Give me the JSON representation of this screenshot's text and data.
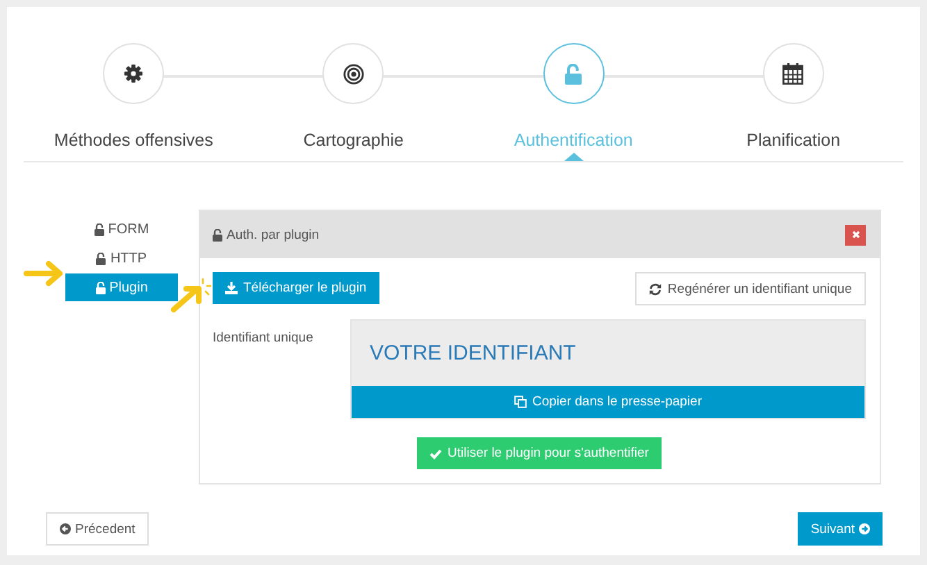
{
  "steps": [
    {
      "label": "Méthodes offensives",
      "kind": "gear",
      "selected": false
    },
    {
      "label": "Cartographie",
      "kind": "target",
      "selected": false
    },
    {
      "label": "Authentification",
      "kind": "unlock",
      "selected": true
    },
    {
      "label": "Planification",
      "kind": "calendar",
      "selected": false
    }
  ],
  "methods": [
    {
      "label": "FORM",
      "selected": false
    },
    {
      "label": "HTTP",
      "selected": false
    },
    {
      "label": "Plugin",
      "selected": true
    }
  ],
  "panel": {
    "title": "Auth. par plugin",
    "download_button": "Télécharger le plugin",
    "regenerate_button": "Regénérer un identifiant unique",
    "id_label": "Identifiant unique",
    "id_value": "VOTRE IDENTIFIANT",
    "copy_button": "Copier dans le presse-papier",
    "use_button": "Utiliser le plugin pour s'authentifier"
  },
  "nav": {
    "previous": "Précedent",
    "next": "Suivant"
  }
}
